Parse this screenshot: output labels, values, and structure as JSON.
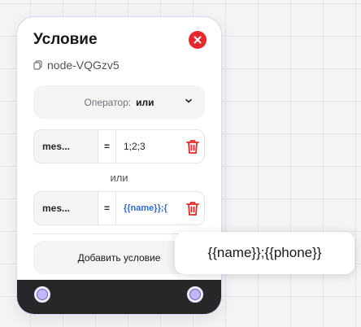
{
  "node": {
    "title": "Условие",
    "id": "node-VQGzv5",
    "operator": {
      "label": "Оператор:",
      "value": "или"
    },
    "conditions": [
      {
        "field": "mes...",
        "operator": "=",
        "value": "1;2;3"
      },
      {
        "field": "mes...",
        "operator": "=",
        "value": "{{name}};{"
      }
    ],
    "or_label": "или",
    "add_button": "Добавить условие"
  },
  "tooltip": {
    "text": "{{name}};{{phone}}"
  },
  "colors": {
    "close": "#e5282d",
    "trash": "#e5282d",
    "template_value": "#2f6bd8",
    "footer": "#27272a",
    "handle": "#c4b5fd"
  },
  "icons": {
    "close": "close-icon",
    "copy": "copy-icon",
    "chevron": "chevron-down-icon",
    "trash": "trash-icon"
  }
}
